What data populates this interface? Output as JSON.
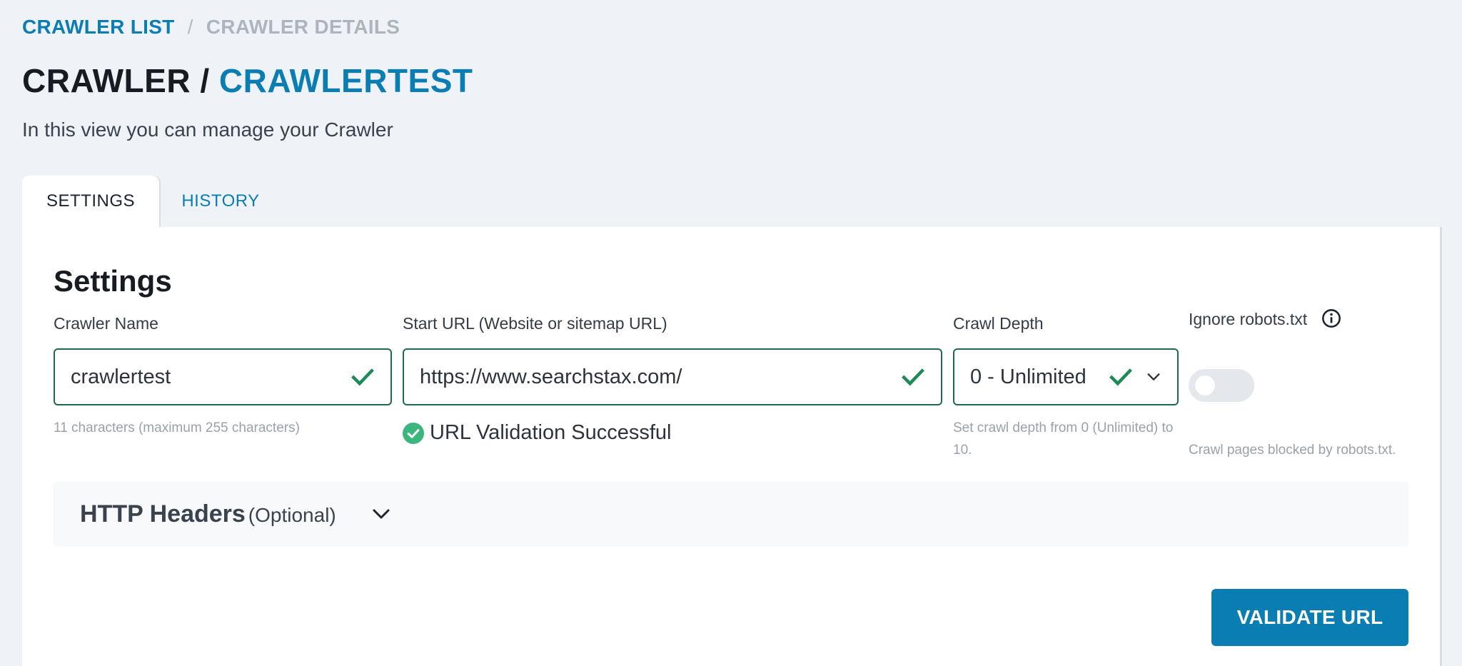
{
  "breadcrumb": {
    "link": "CRAWLER LIST",
    "separator": "/",
    "current": "CRAWLER DETAILS"
  },
  "header": {
    "title_prefix": "CRAWLER /",
    "title_name": "CRAWLERTEST",
    "subtitle": "In this view you can manage your Crawler"
  },
  "tabs": [
    {
      "label": "SETTINGS",
      "active": true
    },
    {
      "label": "HISTORY",
      "active": false
    }
  ],
  "settings": {
    "title": "Settings",
    "crawler_name": {
      "label": "Crawler Name",
      "value": "crawlertest",
      "hint": "11 characters (maximum 255 characters)"
    },
    "start_url": {
      "label": "Start URL (Website or sitemap URL)",
      "value": "https://www.searchstax.com/",
      "validation": "URL Validation Successful"
    },
    "crawl_depth": {
      "label": "Crawl Depth",
      "value": "0 - Unlimited",
      "hint": "Set crawl depth from 0 (Unlimited) to 10."
    },
    "ignore_robots": {
      "label": "Ignore robots.txt",
      "enabled": false,
      "hint": "Crawl pages blocked by robots.txt."
    },
    "http_headers": {
      "title": "HTTP Headers",
      "optional": "(Optional)"
    },
    "validate_button": "VALIDATE URL"
  },
  "colors": {
    "accent": "#0a7db3",
    "success": "#1e8a57",
    "valid_border": "#1e6a4f",
    "background": "#eff3f8"
  }
}
